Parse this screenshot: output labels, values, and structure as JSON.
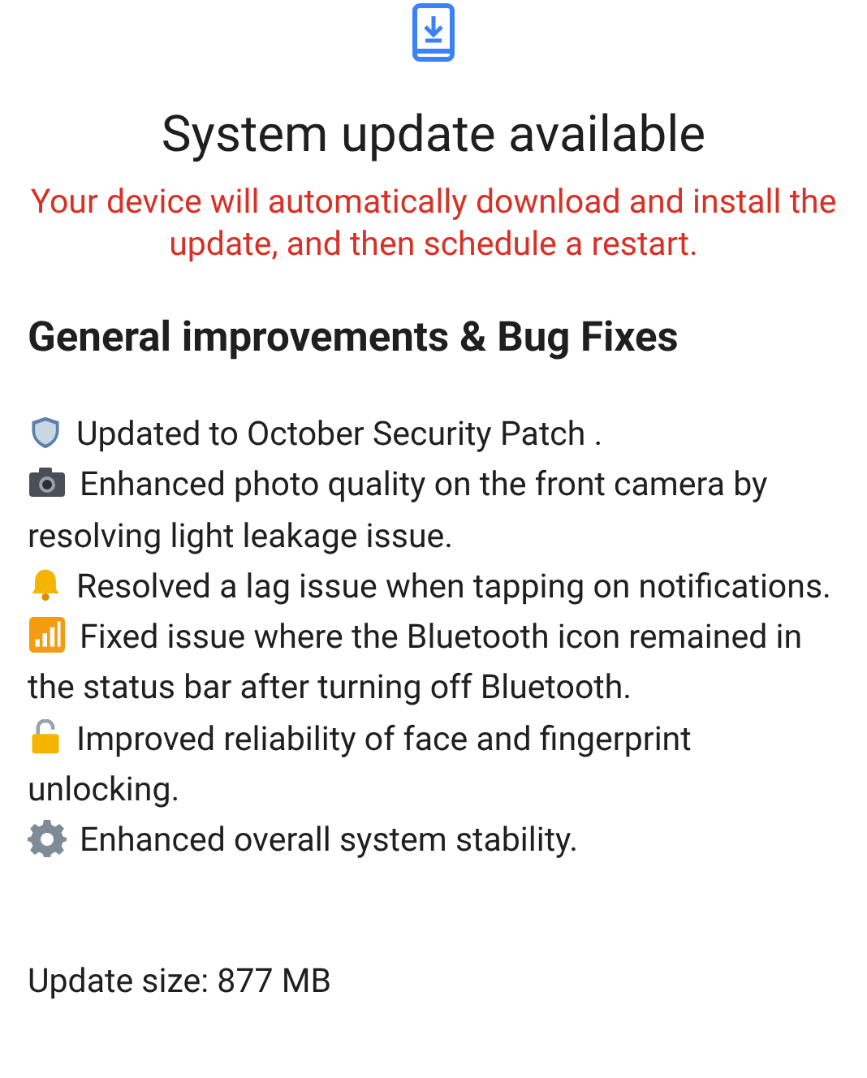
{
  "title": "System update available",
  "warning": "Your device will automatically download and install the update, and then schedule a restart.",
  "heading": "General improvements & Bug Fixes",
  "items": [
    {
      "text": "Updated to October Security Patch ."
    },
    {
      "text": "Enhanced photo quality on the front camera by resolving light leakage issue."
    },
    {
      "text": "Resolved a lag issue when tapping on notifications."
    },
    {
      "text": "Fixed issue where the Bluetooth icon remained in the status bar after turning off Bluetooth."
    },
    {
      "text": "Improved reliability of face and fingerprint unlocking."
    },
    {
      "text": "Enhanced overall system stability."
    }
  ],
  "update_size": "Update size: 877 MB"
}
